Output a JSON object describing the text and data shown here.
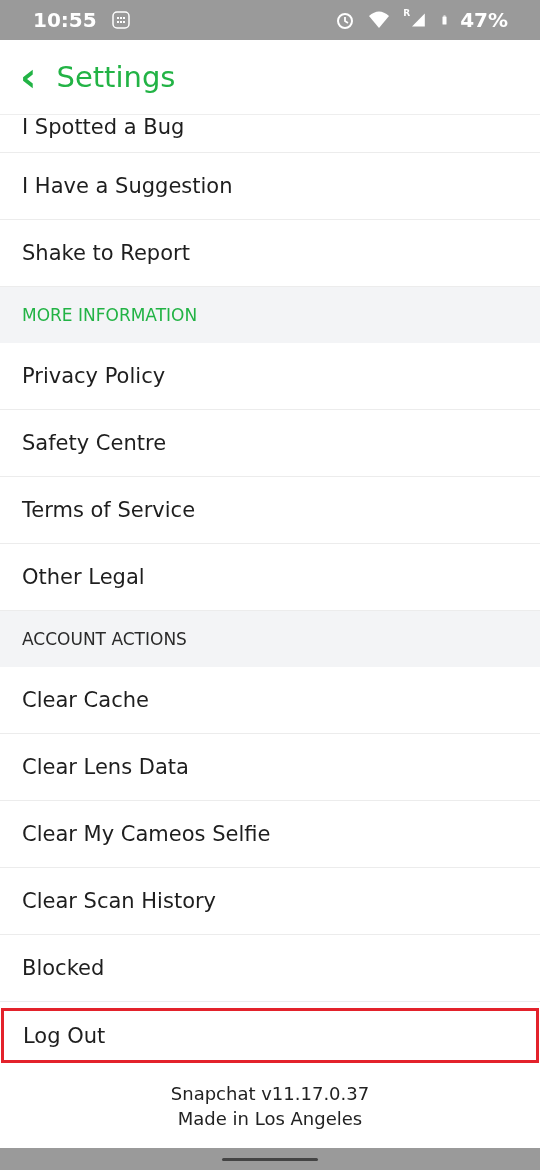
{
  "status_bar": {
    "time": "10:55",
    "signal_mark": "R",
    "battery": "47%"
  },
  "header": {
    "back": "‹",
    "title": "Settings"
  },
  "rows": [
    {
      "kind": "item",
      "label": "I Spotted a Bug",
      "highlighted": false,
      "partial": true
    },
    {
      "kind": "item",
      "label": "I Have a Suggestion",
      "highlighted": false,
      "partial": false
    },
    {
      "kind": "item",
      "label": "Shake to Report",
      "highlighted": false,
      "partial": false
    },
    {
      "kind": "section",
      "label": "MORE INFORMATION",
      "color": "#22b345"
    },
    {
      "kind": "item",
      "label": "Privacy Policy",
      "highlighted": false,
      "partial": false
    },
    {
      "kind": "item",
      "label": "Safety Centre",
      "highlighted": false,
      "partial": false
    },
    {
      "kind": "item",
      "label": "Terms of Service",
      "highlighted": false,
      "partial": false
    },
    {
      "kind": "item",
      "label": "Other Legal",
      "highlighted": false,
      "partial": false
    },
    {
      "kind": "section",
      "label": "ACCOUNT ACTIONS",
      "color": "#2a2a2a"
    },
    {
      "kind": "item",
      "label": "Clear Cache",
      "highlighted": false,
      "partial": false
    },
    {
      "kind": "item",
      "label": "Clear Lens Data",
      "highlighted": false,
      "partial": false
    },
    {
      "kind": "item",
      "label": "Clear My Cameos Selfie",
      "highlighted": false,
      "partial": false
    },
    {
      "kind": "item",
      "label": "Clear Scan History",
      "highlighted": false,
      "partial": false
    },
    {
      "kind": "item",
      "label": "Blocked",
      "highlighted": false,
      "partial": false
    },
    {
      "kind": "item",
      "label": "Log Out",
      "highlighted": true,
      "partial": false
    }
  ],
  "footer": [
    "Snapchat v11.17.0.37",
    "Made in Los Angeles"
  ]
}
